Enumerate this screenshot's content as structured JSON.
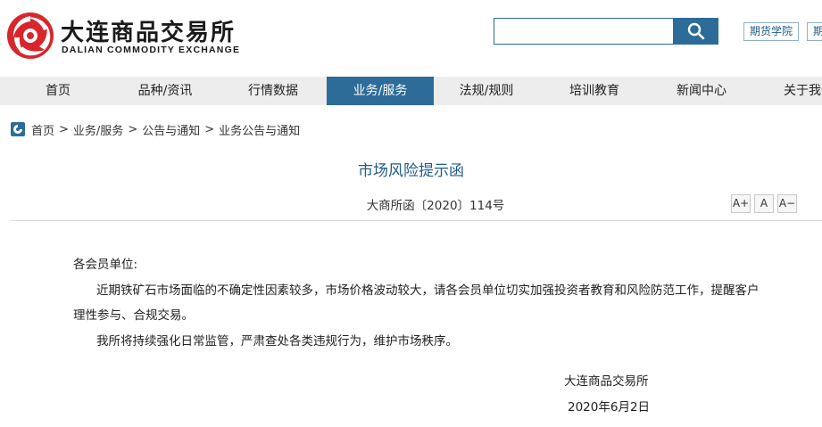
{
  "header": {
    "logo": {
      "cn_name": "大连商品交易所",
      "en_name": "DALIAN COMMODITY EXCHANGE",
      "brand_color": "#d8262c"
    },
    "search": {
      "value": "",
      "placeholder": "",
      "button_icon": "search-icon"
    },
    "links": [
      {
        "label": "期货学院"
      },
      {
        "label": "期"
      }
    ]
  },
  "nav": {
    "active_color": "#2d6b98",
    "items": [
      {
        "label": "首页"
      },
      {
        "label": "品种/资讯"
      },
      {
        "label": "行情数据"
      },
      {
        "label": "业务/服务"
      },
      {
        "label": "法规/规则"
      },
      {
        "label": "培训教育"
      },
      {
        "label": "新闻中心"
      },
      {
        "label": "关于我们"
      }
    ],
    "active_index": 3
  },
  "breadcrumb": {
    "icon": "site-logo-icon",
    "items": [
      "首页",
      "业务/服务",
      "公告与通知",
      "业务公告与通知"
    ],
    "separator": ">"
  },
  "article": {
    "title": "市场风险提示函",
    "doc_no": "大商所函〔2020〕114号",
    "font_controls": [
      "A+",
      "A",
      "A−"
    ],
    "salutation": "各会员单位:",
    "para1_line1": "近期铁矿石市场面临的不确定性因素较多，市场价格波动较大，请各会员单位切实加强投资者教育和风险防范工作，提醒客户",
    "para1_line2": "理性参与、合规交易。",
    "para2": "我所将持续强化日常监管，严肃查处各类违规行为，维护市场秩序。",
    "signature_org": "大连商品交易所",
    "signature_date": "2020年6月2日"
  }
}
